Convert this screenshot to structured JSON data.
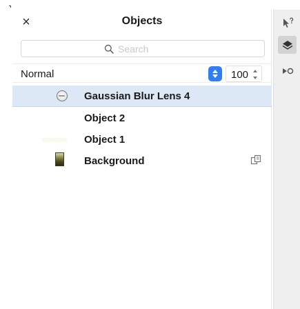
{
  "panel": {
    "title": "Objects",
    "close_symbol": "×",
    "search": {
      "placeholder": "Search",
      "value": ""
    },
    "blend_mode": "Normal",
    "opacity": "100"
  },
  "layers": [
    {
      "label": "Gaussian Blur Lens 4",
      "thumbnail": "lens-icon",
      "selected": true
    },
    {
      "label": "Object 2",
      "thumbnail": "none",
      "selected": false
    },
    {
      "label": "Object 1",
      "thumbnail": "object-thumbnail",
      "selected": false
    },
    {
      "label": "Background",
      "thumbnail": "background-thumbnail",
      "selected": false,
      "badge": "link-icon"
    }
  ],
  "toolbar": {
    "tools": [
      {
        "icon": "arrow-help-icon"
      },
      {
        "icon": "layers-icon",
        "active": true
      },
      {
        "icon": "play-circle-icon"
      }
    ]
  },
  "colors": {
    "selection_row": "#dce8f6",
    "accent_blue": "#2f7ff3",
    "toolbar_bg": "#efefef"
  }
}
